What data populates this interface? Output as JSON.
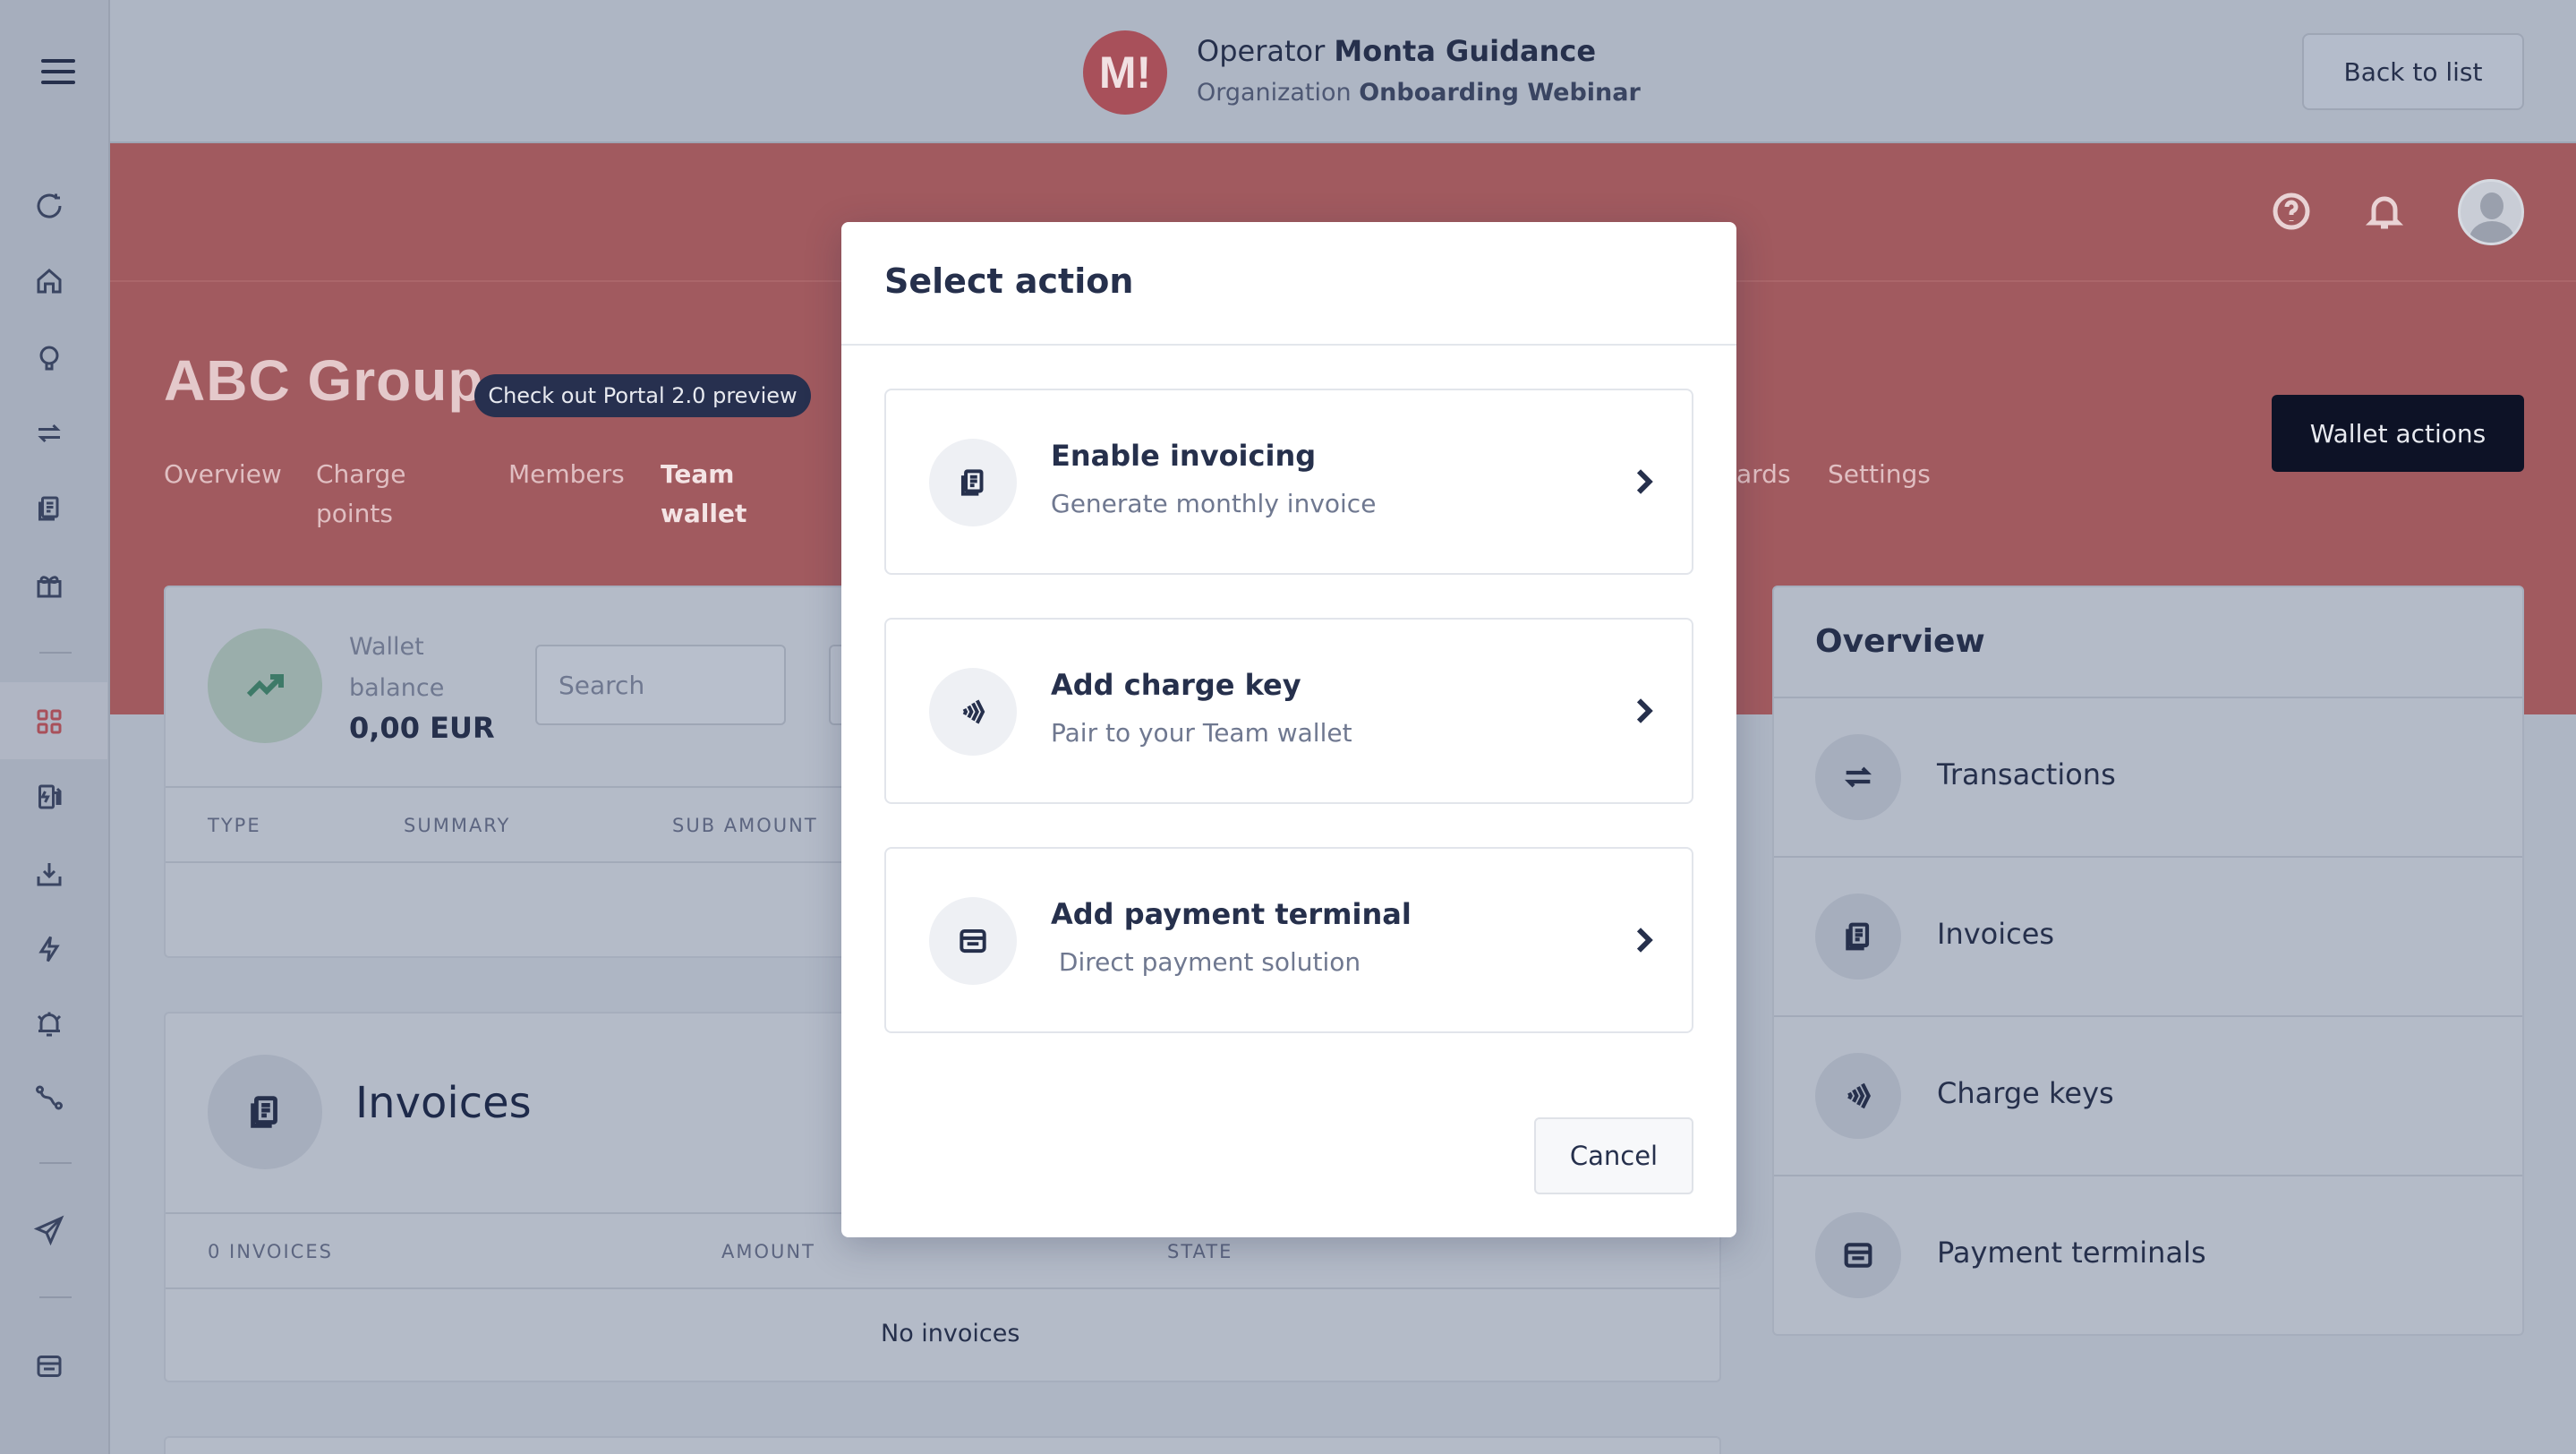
{
  "header": {
    "org_logo_letter": "M!",
    "operator_prefix": "Operator",
    "operator_name": "Monta Guidance",
    "organization_prefix": "Organization",
    "organization_name": "Onboarding Webinar",
    "back_label": "Back to list"
  },
  "page": {
    "title": "ABC Group",
    "preview_badge": "Check out Portal 2.0 preview",
    "wallet_actions_label": "Wallet actions",
    "tabs": [
      {
        "line1": "Overview",
        "line2": ""
      },
      {
        "line1": "Charge",
        "line2": "points"
      },
      {
        "line1": "Members",
        "line2": ""
      },
      {
        "line1": "Team",
        "line2": "wallet"
      },
      {
        "line1": "ards",
        "line2": ""
      },
      {
        "line1": "Settings",
        "line2": ""
      }
    ]
  },
  "wallet_card": {
    "label_line1": "Wallet",
    "label_line2": "balance",
    "balance": "0,00 EUR",
    "search_placeholder": "Search",
    "columns": [
      "TYPE",
      "SUMMARY",
      "SUB AMOUNT"
    ]
  },
  "invoices_card": {
    "title": "Invoices",
    "columns": [
      "0 INVOICES",
      "AMOUNT",
      "STATE"
    ],
    "empty_text": "No invoices"
  },
  "overview": {
    "title": "Overview",
    "items": [
      {
        "label": "Transactions",
        "icon": "transfer-icon"
      },
      {
        "label": "Invoices",
        "icon": "invoice-icon"
      },
      {
        "label": "Charge keys",
        "icon": "nfc-icon"
      },
      {
        "label": "Payment terminals",
        "icon": "terminal-icon"
      }
    ]
  },
  "modal": {
    "title": "Select action",
    "actions": [
      {
        "title": "Enable invoicing",
        "subtitle": "Generate monthly invoice",
        "icon": "invoice-icon"
      },
      {
        "title": "Add charge key",
        "subtitle": "Pair to your Team wallet",
        "icon": "nfc-icon"
      },
      {
        "title": "Add payment terminal",
        "subtitle": " Direct payment solution",
        "icon": "terminal-icon"
      }
    ],
    "cancel_label": "Cancel"
  },
  "colors": {
    "accent_red": "#a15a5f",
    "dark_navy": "#0d1226",
    "text_primary": "#26304c"
  }
}
